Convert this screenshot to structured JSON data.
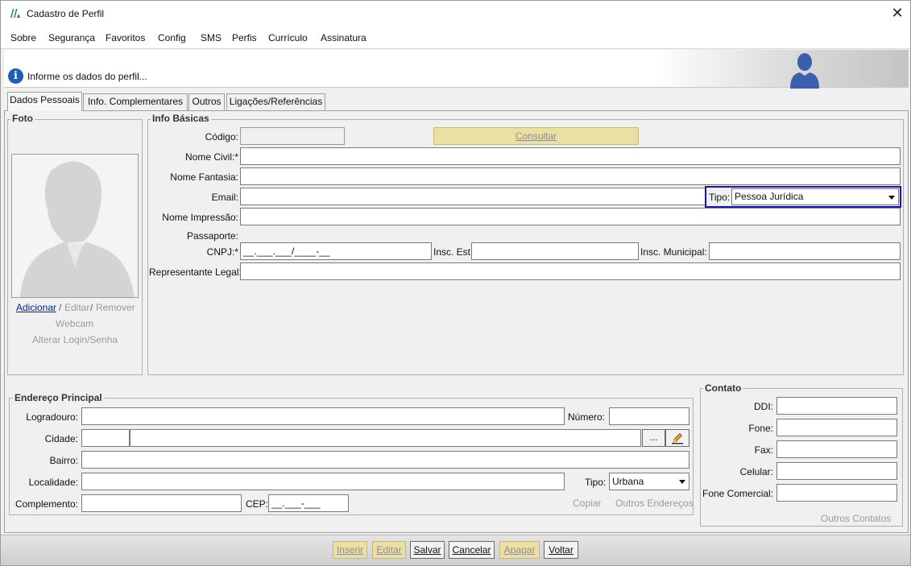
{
  "window": {
    "title": "Cadastro de Perfil"
  },
  "menu": [
    {
      "label": "Sobre"
    },
    {
      "label": "Segurança"
    },
    {
      "label": "Favoritos"
    },
    {
      "label": "Config"
    },
    {
      "label": "SMS"
    },
    {
      "label": "Perfis"
    },
    {
      "label": "Currículo"
    },
    {
      "label": "Assinatura"
    }
  ],
  "banner": {
    "message": "Informe os dados do perfil..."
  },
  "tabs": [
    {
      "label": "Dados Pessoais"
    },
    {
      "label": "Info. Complementares"
    },
    {
      "label": "Outros"
    },
    {
      "label": "Ligações/Referências"
    }
  ],
  "foto": {
    "group_label": "Foto",
    "adicionar": "Adicionar",
    "sep1": "/",
    "editar": "Editar",
    "sep2": "/",
    "remover": "Remover",
    "webcam": "Webcam",
    "alterar_login": "Alterar Loqin/Senha"
  },
  "info_basicas": {
    "group_label": "Info Básicas",
    "codigo_label": "Código:",
    "codigo_value": "",
    "consultar_label": "Consultar",
    "nome_civil_label": "Nome Civil:*",
    "nome_civil_value": "",
    "nome_fantasia_label": "Nome Fantasia:",
    "nome_fantasia_value": "",
    "email_label": "Email:",
    "email_value": "",
    "tipo_label": "Tipo:",
    "tipo_value": "Pessoa Jurídica",
    "nome_impressao_label": "Nome Impressão:",
    "nome_impressao_value": "",
    "passaporte_label": "Passaporte:",
    "cnpj_label": "CNPJ:*",
    "cnpj_value": "__.___.___/____-__",
    "insc_est_label": "Insc. Est:",
    "insc_est_value": "",
    "insc_mun_label": "Insc. Municipal:",
    "insc_mun_value": "",
    "representante_label": "Representante Legal:",
    "representante_value": ""
  },
  "endereco": {
    "group_label": "Endereço Principal",
    "logradouro_label": "Logradouro:",
    "logradouro_value": "",
    "numero_label": "Número:",
    "numero_value": "",
    "cidade_label": "Cidade:",
    "cidade_code": "",
    "cidade_value": "",
    "ellipsis": "...",
    "bairro_label": "Bairro:",
    "bairro_value": "",
    "localidade_label": "Localidade:",
    "localidade_value": "",
    "tipo_label": "Tipo:",
    "tipo_value": "Urbana",
    "complemento_label": "Complemento:",
    "complemento_value": "",
    "cep_label": "CEP:",
    "cep_value": "__.___-___",
    "copiar": "Copiar",
    "outros_enderecos": "Outros Endereços"
  },
  "contato": {
    "group_label": "Contato",
    "ddi_label": "DDI:",
    "fone_label": "Fone:",
    "fax_label": "Fax:",
    "celular_label": "Celular:",
    "fone_comercial_label": "Fone Comercial:",
    "outros_contatos": "Outros Contatos"
  },
  "buttons": {
    "inserir": "Inserir",
    "editar": "Editar",
    "salvar": "Salvar",
    "cancelar": "Cancelar",
    "apagar": "Apagar",
    "voltar": "Voltar"
  },
  "colors": {
    "focus_border": "#1414c8",
    "disabled_button": "#ecdfa4",
    "link": "#0026a8",
    "info_icon": "#1d5fb3"
  },
  "icons": [
    "app-logo-icon",
    "close-icon",
    "info-icon",
    "user-silhouette-icon",
    "dropdown-arrow-icon",
    "pencil-icon",
    "ellipsis-icon"
  ]
}
